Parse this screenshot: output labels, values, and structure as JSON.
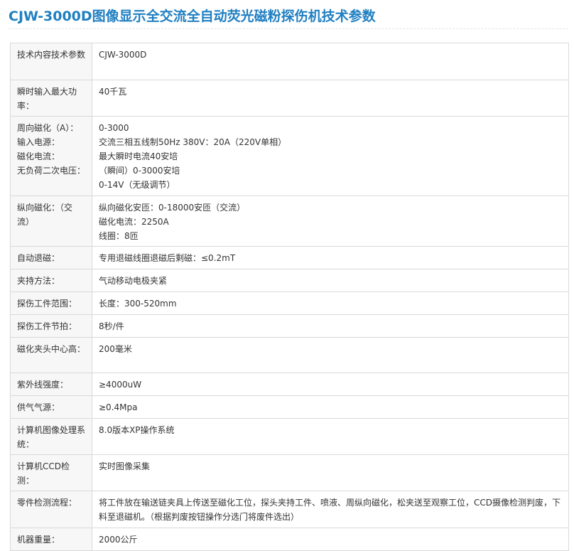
{
  "title": "CJW-3000D图像显示全交流全自动荧光磁粉探伤机技术参数",
  "rows": [
    {
      "key": "技术内容技术参数",
      "value": "CJW-3000D"
    },
    {
      "key": "瞬时输入最大功率：",
      "value": "40千瓦"
    },
    {
      "key": "周向磁化（A）：\n输入电源：\n磁化电流：\n无负荷二次电压：",
      "value": "0-3000\n交流三相五线制50Hz 380V：20A（220V单相）\n最大瞬时电流40安培\n（瞬间）0-3000安培\n0-14V（无级调节）"
    },
    {
      "key": "纵向磁化：（交流）",
      "value": "纵向磁化安匝：0-18000安匝（交流）\n磁化电流：2250A\n线圈：8匝"
    },
    {
      "key": "自动退磁：",
      "value": "专用退磁线圈退磁后剩磁：≤0.2mT"
    },
    {
      "key": "夹持方法：",
      "value": "气动移动电极夹紧"
    },
    {
      "key": "探伤工件范围：",
      "value": "长度：300-520mm"
    },
    {
      "key": "探伤工件节拍：",
      "value": "8秒/件"
    },
    {
      "key": "磁化夹头中心高：",
      "value": "200毫米"
    },
    {
      "key": "紫外线强度：",
      "value": "≥4000uW"
    },
    {
      "key": "供气气源：",
      "value": "≥0.4Mpa"
    },
    {
      "key": "计算机图像处理系统：",
      "value": "8.0版本XP操作系统"
    },
    {
      "key": "计算机CCD检测：",
      "value": "实时图像采集"
    },
    {
      "key": "零件检测流程：",
      "value": "将工件放在输送链夹具上传送至磁化工位，探头夹持工件、喷液、周纵向磁化，松夹送至观察工位，CCD摄像检测判废，下料至退磁机。（根据判废按钮操作分选门将废件选出）"
    },
    {
      "key": "机器重量：",
      "value": "2000公斤"
    }
  ]
}
